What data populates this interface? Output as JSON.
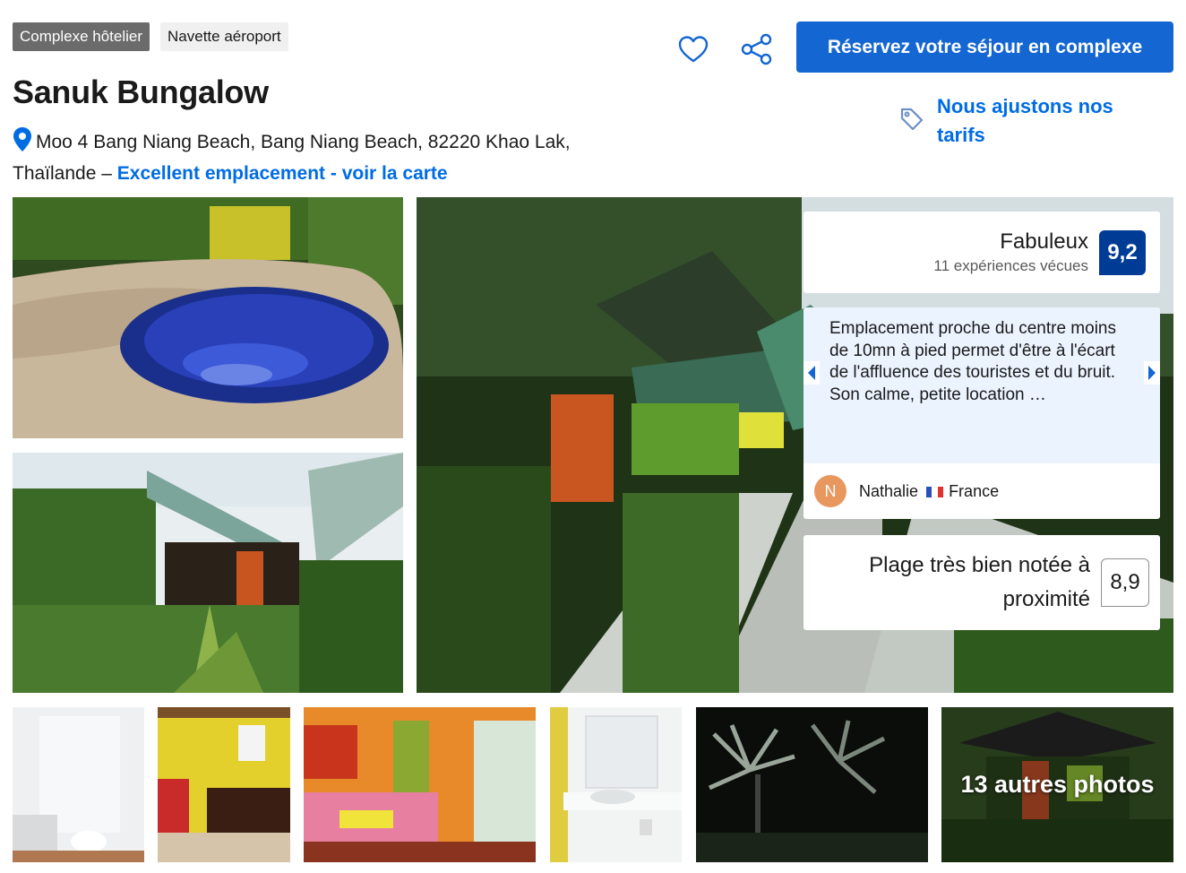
{
  "badges": {
    "type": "Complexe hôtelier",
    "shuttle": "Navette aéroport"
  },
  "property": {
    "name": "Sanuk Bungalow",
    "address": "Moo 4 Bang Niang Beach, Bang Niang Beach, 82220 Khao Lak, Thaïlande – ",
    "location_link": "Excellent emplacement - voir la carte"
  },
  "actions": {
    "reserve_label": "Réservez votre séjour en complexe",
    "price_match": "Nous ajustons nos tarifs",
    "save_icon": "heart-icon",
    "share_icon": "share-icon"
  },
  "review_score": {
    "rating_word": "Fabuleux",
    "review_count": "11 expériences vécues",
    "score": "9,2"
  },
  "featured_review": {
    "text": "Emplacement proche du centre moins de 10mn à pied permet d'être à l'écart de l'affluence des touristes et du bruit. Son calme, petite location …",
    "author_initial": "N",
    "author_name": "Nathalie",
    "author_country": "France"
  },
  "beach_rating": {
    "label": "Plage très bien notée à proximité",
    "score": "8,9"
  },
  "gallery": {
    "more_photos": "13 autres photos"
  },
  "colors": {
    "primary": "#1466d2",
    "link": "#006ce4",
    "score_bg": "#003b95",
    "quote_bg": "#ebf3ff"
  }
}
